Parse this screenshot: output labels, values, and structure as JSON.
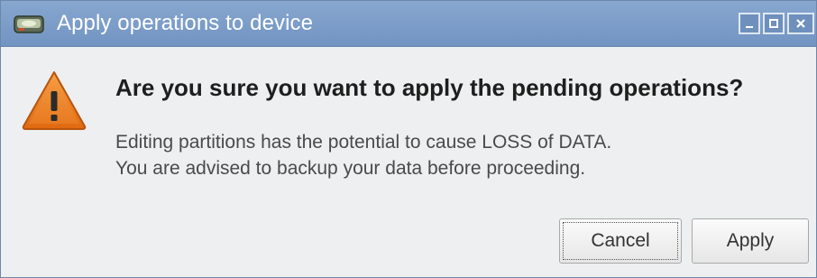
{
  "window": {
    "title": "Apply operations to device",
    "controls": {
      "minimize": "minimize",
      "maximize": "maximize",
      "close": "close"
    }
  },
  "dialog": {
    "icon": "warning-icon",
    "headline": "Are you sure you want to apply the pending operations?",
    "message_lines": [
      "Editing partitions has the potential to cause LOSS of DATA.",
      "You are advised to backup your data before proceeding."
    ]
  },
  "buttons": {
    "cancel": "Cancel",
    "apply": "Apply"
  },
  "colors": {
    "titlebar": "#7b9cc7",
    "dialog_bg": "#edeff0",
    "warning_orange": "#e8731c"
  }
}
